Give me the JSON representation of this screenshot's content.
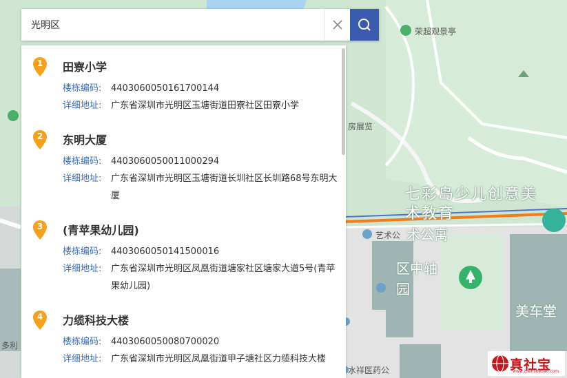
{
  "search": {
    "value": "光明区"
  },
  "map": {
    "labels": {
      "rongchao": "荣超观景亭",
      "fangzhan": "房展览",
      "qicaidao_line1": "七彩岛少儿创意美",
      "qicaidao_line2": "术教育",
      "gongyu": "术公寓",
      "zhongzhou": "区中轴",
      "yuan": "园",
      "meiche": "美车堂",
      "yishu": "艺术公",
      "duoli": "多利",
      "yaofang": "水祥医药公"
    }
  },
  "results": [
    {
      "index": "1",
      "title": "田寮小学",
      "code_label": "楼栋编码:",
      "code": "4403060050161700144",
      "addr_label": "详细地址:",
      "addr": "广东省深圳市光明区玉塘街道田寮社区田寮小学"
    },
    {
      "index": "2",
      "title": "东明大厦",
      "code_label": "楼栋编码:",
      "code": "4403060050011000294",
      "addr_label": "详细地址:",
      "addr": "广东省深圳市光明区玉塘街道长圳社区长圳路68号东明大厦"
    },
    {
      "index": "3",
      "title": "(青苹果幼儿园)",
      "code_label": "楼栋编码:",
      "code": "4403060050141500016",
      "addr_label": "详细地址:",
      "addr": "广东省深圳市光明区凤凰街道塘家社区塘家大道5号(青苹果幼儿园)"
    },
    {
      "index": "4",
      "title": "力缆科技大楼",
      "code_label": "楼栋编码:",
      "code": "4403060050080700020",
      "addr_label": "详细地址:",
      "addr": "广东省深圳市光明区凤凰街道甲子塘社区力缆科技大楼"
    }
  ],
  "logo": {
    "text": "真社宝",
    "sub": "www.zhenshebao.com"
  },
  "colors": {
    "accent": "#3a5bb0",
    "pin": "#f5a11c",
    "label_blue": "#3a6db5",
    "map_green": "#cfe6d2"
  }
}
